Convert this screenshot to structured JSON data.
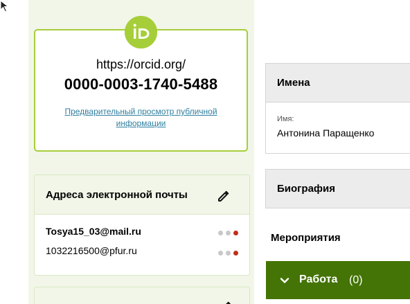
{
  "colors": {
    "brand_green": "#a6ce39",
    "panel_bg": "#f1f6e8",
    "link": "#2e7f9f",
    "dark_green": "#447405",
    "visibility_red": "#c0301b"
  },
  "id_card": {
    "logo_text": "iD",
    "url_prefix": "https://orcid.org/",
    "orcid_id": "0000-0003-1740-5488",
    "preview_link": "Предварительный просмотр публичной информации"
  },
  "emails": {
    "title": "Адреса электронной почты",
    "edit_icon": "pencil-icon",
    "items": [
      {
        "address": "Tosya15_03@mail.ru",
        "primary": true
      },
      {
        "address": "1032216500@pfur.ru",
        "primary": false
      }
    ]
  },
  "third_card": {
    "title": ""
  },
  "names": {
    "title": "Имена",
    "label": "Имя:",
    "value": "Антонина Паращенко"
  },
  "biography": {
    "title": "Биография"
  },
  "events": {
    "title": "Мероприятия"
  },
  "work": {
    "label": "Работа",
    "count": "(0)",
    "chevron_icon": "chevron-down-icon"
  }
}
